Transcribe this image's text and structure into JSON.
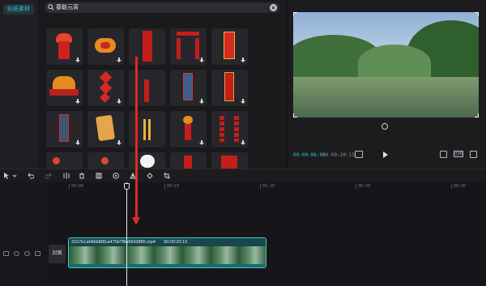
{
  "sidebar": {
    "category_label": "贴纸素材"
  },
  "search": {
    "query": "春联元宵"
  },
  "stickers": [
    {
      "name": "lion-dance-scroll",
      "downloaded": true
    },
    {
      "name": "lion-head",
      "downloaded": true
    },
    {
      "name": "red-banner",
      "downloaded": false
    },
    {
      "name": "couplet-set",
      "downloaded": true
    },
    {
      "name": "red-card-vertical",
      "downloaded": true
    },
    {
      "name": "lion-new-year",
      "downloaded": true
    },
    {
      "name": "diamond-couplet",
      "downloaded": true
    },
    {
      "name": "red-pillar",
      "downloaded": false
    },
    {
      "name": "blue-couplet",
      "downloaded": true
    },
    {
      "name": "gold-frame-pillar",
      "downloaded": true
    },
    {
      "name": "round-couplet",
      "downloaded": true
    },
    {
      "name": "scroll-rolled",
      "downloaded": true
    },
    {
      "name": "gold-sticks",
      "downloaded": false
    },
    {
      "name": "lion-couplet",
      "downloaded": true
    },
    {
      "name": "dot-couplets",
      "downloaded": true
    }
  ],
  "preview": {
    "current_time": "00:00:06:03",
    "total_time": "00:00:20:13",
    "ratio_label": "比例"
  },
  "timeline": {
    "ruler_ticks": [
      "00:00",
      "00:10",
      "00:20",
      "00:30",
      "00:40"
    ],
    "cover_label": "封面",
    "clip_filename": "3167b1afd9dd881a475b7f8a6543885.mp4",
    "clip_duration": "00:00:20:13"
  },
  "colors": {
    "accent": "#2ec4d6",
    "clip_border": "#48c6c3",
    "annotation_arrow": "#e02a24"
  }
}
